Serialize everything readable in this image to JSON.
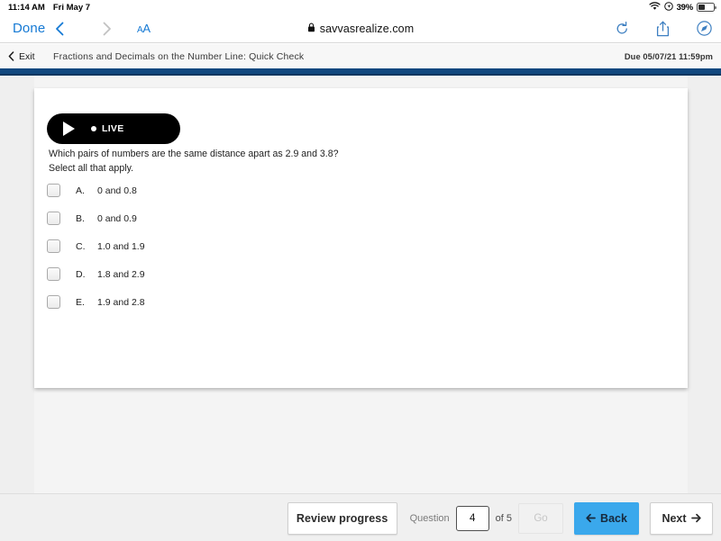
{
  "status_bar": {
    "time": "11:14 AM",
    "date": "Fri May 7",
    "battery_percent": "39%",
    "wifi_icon": "wifi-icon",
    "location_icon": "location-icon",
    "battery_icon": "battery-icon"
  },
  "browser": {
    "done_label": "Done",
    "back_icon": "chevron-left-icon",
    "forward_icon": "chevron-right-icon",
    "text_size_label": "AA",
    "lock_icon": "lock-icon",
    "url": "savvasrealize.com",
    "reload_icon": "reload-icon",
    "share_icon": "share-icon",
    "tabs_icon": "safari-compass-icon"
  },
  "app_header": {
    "exit_label": "Exit",
    "exit_icon": "chevron-left-icon",
    "assignment_title": "Fractions and Decimals on the Number Line: Quick Check",
    "due_text": "Due 05/07/21 11:59pm",
    "stripe_color": "#11487f"
  },
  "question_card": {
    "live_badge": {
      "play_icon": "play-icon",
      "dot_icon": "live-dot-icon",
      "label": "LIVE"
    },
    "prompt_line1": "Which pairs of numbers are the same distance apart as 2.9 and 3.8?",
    "prompt_line2": "Select all that apply.",
    "options": [
      {
        "letter": "A.",
        "text": "0 and 0.8",
        "checked": false
      },
      {
        "letter": "B.",
        "text": "0 and 0.9",
        "checked": false
      },
      {
        "letter": "C.",
        "text": "1.0 and 1.9",
        "checked": false
      },
      {
        "letter": "D.",
        "text": "1.8 and 2.9",
        "checked": false
      },
      {
        "letter": "E.",
        "text": "1.9 and 2.8",
        "checked": false
      }
    ]
  },
  "footer": {
    "review_label": "Review progress",
    "question_label": "Question",
    "question_number": "4",
    "of_label": "of 5",
    "go_label": "Go",
    "back_label": "Back",
    "back_icon": "arrow-left-icon",
    "back_color": "#3aa8ec",
    "next_label": "Next",
    "next_icon": "arrow-right-icon"
  }
}
